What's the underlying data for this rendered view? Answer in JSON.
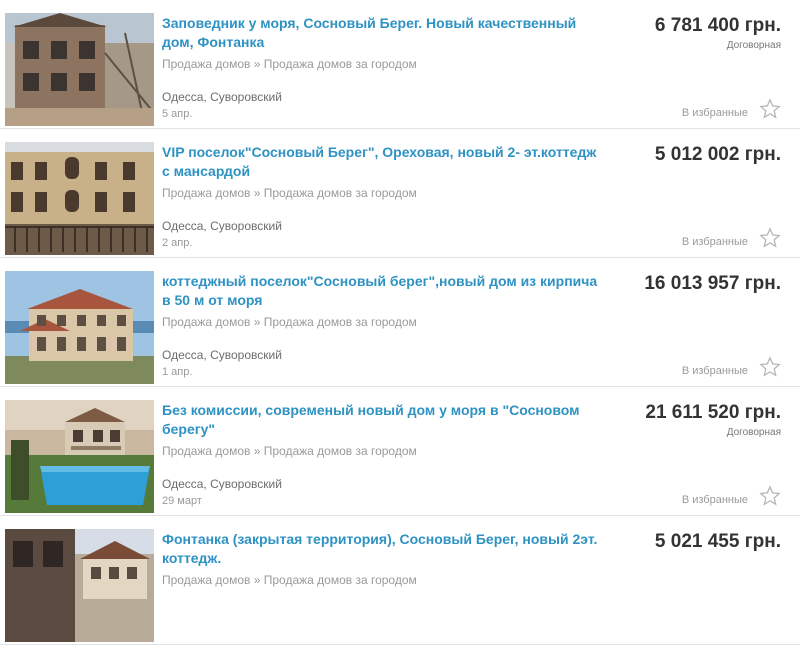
{
  "listings": [
    {
      "title": "Заповедник у моря, Сосновый Берег. Новый качественный дом, Фонтанка",
      "category": "Продажа домов » Продажа домов за городом",
      "location": "Одесса, Суворовский",
      "date": "5 апр.",
      "price": "6 781 400 грн.",
      "negotiable": "Договорная",
      "favorite_label": "В избранные",
      "icon": "star-icon"
    },
    {
      "title": "VIP поселок\"Сосновый Берег\", Ореховая, новый 2- эт.коттедж с мансардой",
      "category": "Продажа домов » Продажа домов за городом",
      "location": "Одесса, Суворовский",
      "date": "2 апр.",
      "price": "5 012 002 грн.",
      "negotiable": "",
      "favorite_label": "В избранные",
      "icon": "star-icon"
    },
    {
      "title": "коттеджный поселок\"Сосновый берег\",новый дом из кирпича в 50 м от моря",
      "category": "Продажа домов » Продажа домов за городом",
      "location": "Одесса, Суворовский",
      "date": "1 апр.",
      "price": "16 013 957 грн.",
      "negotiable": "",
      "favorite_label": "В избранные",
      "icon": "star-icon"
    },
    {
      "title": "Без комиссии, современый новый дом у моря в \"Сосновом берегу\"",
      "category": "Продажа домов » Продажа домов за городом",
      "location": "Одесса, Суворовский",
      "date": "29 март",
      "price": "21 611 520 грн.",
      "negotiable": "Договорная",
      "favorite_label": "В избранные",
      "icon": "star-icon"
    },
    {
      "title": "Фонтанка (закрытая территория), Сосновый Берег, новый 2эт. коттедж.",
      "category": "Продажа домов » Продажа домов за городом",
      "location": "",
      "date": "",
      "price": "5 021 455 грн.",
      "negotiable": "",
      "favorite_label": "",
      "icon": "star-icon"
    }
  ],
  "colors": {
    "title_link": "#2e92c3",
    "price": "#333333",
    "muted": "#9a9a9a",
    "divider": "#e3e3e3"
  }
}
